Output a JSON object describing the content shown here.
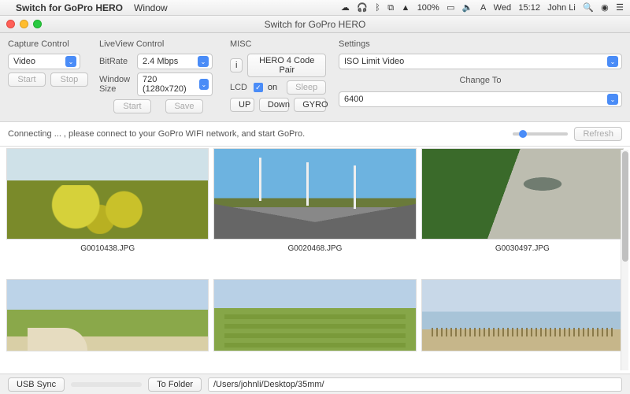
{
  "menubar": {
    "app_name": "Switch for GoPro HERO",
    "menus": [
      "Window"
    ],
    "right": {
      "battery": "100%",
      "day": "Wed",
      "time": "15:12",
      "user": "John Li"
    }
  },
  "window": {
    "title": "Switch for GoPro HERO"
  },
  "capture": {
    "header": "Capture Control",
    "mode": "Video",
    "start": "Start",
    "stop": "Stop"
  },
  "liveview": {
    "header": "LiveView Control",
    "bitrate_label": "BitRate",
    "bitrate": "2.4 Mbps",
    "winsize_label": "Window\nSize",
    "winsize": "720 (1280x720)",
    "start": "Start",
    "save": "Save"
  },
  "misc": {
    "header": "MISC",
    "pair": "HERO 4 Code Pair",
    "lcd_label": "LCD",
    "lcd_on": "on",
    "sleep": "Sleep",
    "up": "UP",
    "down": "Down",
    "gyro": "GYRO"
  },
  "settings": {
    "header": "Settings",
    "prop": "ISO Limit Video",
    "change_to": "Change To",
    "value": "6400"
  },
  "status": {
    "text": "Connecting ... , please connect to your GoPro WIFI network, and start GoPro.",
    "refresh": "Refresh"
  },
  "gallery": {
    "items": [
      {
        "file": "G0010438.JPG"
      },
      {
        "file": "G0020468.JPG"
      },
      {
        "file": "G0030497.JPG"
      }
    ]
  },
  "footer": {
    "usb_sync": "USB Sync",
    "to_folder": "To Folder",
    "path": "/Users/johnli/Desktop/35mm/"
  }
}
